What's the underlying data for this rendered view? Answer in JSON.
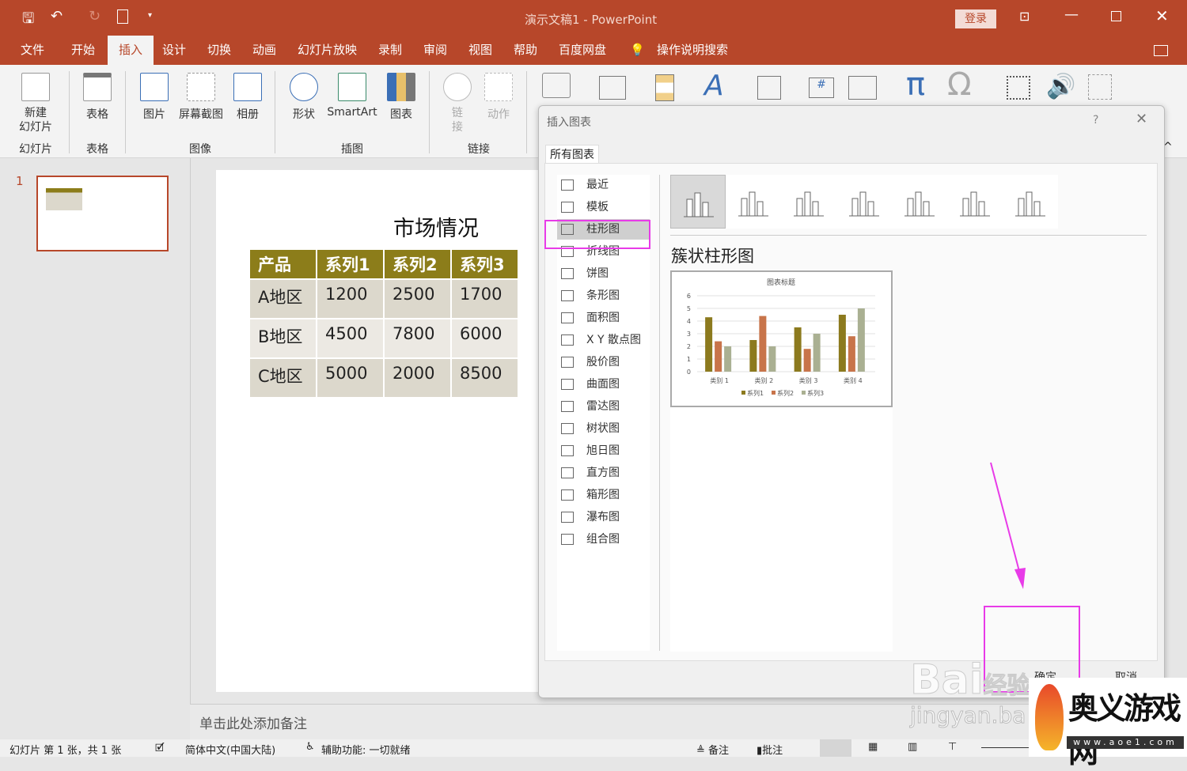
{
  "window": {
    "title": "演示文稿1  -  PowerPoint",
    "login": "登录"
  },
  "tabs": [
    "文件",
    "开始",
    "插入",
    "设计",
    "切换",
    "动画",
    "幻灯片放映",
    "录制",
    "审阅",
    "视图",
    "帮助",
    "百度网盘",
    "操作说明搜索"
  ],
  "ribbon": {
    "buttons": [
      {
        "label": "新建\n幻灯片",
        "icon": "new-slide-icon"
      },
      {
        "label": "表格",
        "icon": "table-icon"
      },
      {
        "label": "图片",
        "icon": "picture-icon"
      },
      {
        "label": "屏幕截图",
        "icon": "screenshot-icon"
      },
      {
        "label": "相册",
        "icon": "album-icon"
      },
      {
        "label": "形状",
        "icon": "shapes-icon"
      },
      {
        "label": "SmartArt",
        "icon": "smartart-icon"
      },
      {
        "label": "图表",
        "icon": "chart-icon"
      },
      {
        "label": "链\n接",
        "icon": "link-icon"
      },
      {
        "label": "动作",
        "icon": "action-icon"
      }
    ],
    "groups": [
      "幻灯片",
      "表格",
      "图像",
      "插图",
      "链接"
    ]
  },
  "slides_panel": {
    "number": "1"
  },
  "slide": {
    "title": "市场情况",
    "table": {
      "headers": [
        "产品",
        "系列1",
        "系列2",
        "系列3"
      ],
      "rows": [
        [
          "A地区",
          "1200",
          "2500",
          "1700"
        ],
        [
          "B地区",
          "4500",
          "7800",
          "6000"
        ],
        [
          "C地区",
          "5000",
          "2000",
          "8500"
        ]
      ]
    }
  },
  "notes_placeholder": "单击此处添加备注",
  "status": {
    "slide": "幻灯片 第 1 张，共 1 张",
    "language": "简体中文(中国大陆)",
    "accessibility": "辅助功能: 一切就绪",
    "notes": "备注",
    "comments": "批注"
  },
  "dialog": {
    "title": "插入图表",
    "help": "?",
    "tab": "所有图表",
    "types": [
      "最近",
      "模板",
      "柱形图",
      "折线图",
      "饼图",
      "条形图",
      "面积图",
      "X Y 散点图",
      "股价图",
      "曲面图",
      "雷达图",
      "树状图",
      "旭日图",
      "直方图",
      "箱形图",
      "瀑布图",
      "组合图"
    ],
    "selected_type": "柱形图",
    "subtype_title": "簇状柱形图",
    "ok": "确定",
    "cancel": "取消"
  },
  "chart_data": {
    "type": "bar",
    "title": "图表标题",
    "categories": [
      "类别 1",
      "类别 2",
      "类别 3",
      "类别 4"
    ],
    "series": [
      {
        "name": "系列1",
        "values": [
          4.3,
          2.5,
          3.5,
          4.5
        ],
        "color": "#8c7a1e"
      },
      {
        "name": "系列2",
        "values": [
          2.4,
          4.4,
          1.8,
          2.8
        ],
        "color": "#c8744a"
      },
      {
        "name": "系列3",
        "values": [
          2,
          2,
          3,
          5
        ],
        "color": "#aab092"
      }
    ],
    "ylim": [
      0,
      6
    ],
    "yticks": [
      "0",
      "1",
      "2",
      "3",
      "4",
      "5",
      "6"
    ],
    "grid": true,
    "legend": "bottom"
  },
  "watermarks": {
    "baidu": "Baidu经验",
    "jingyan": "jingyan.baidu",
    "aoe": "奥义游戏网",
    "aoe_url": "www.aoe1.com"
  },
  "colors": {
    "accent": "#b7472a",
    "highlight": "#e83be8",
    "table_header": "#8c7d1a"
  }
}
